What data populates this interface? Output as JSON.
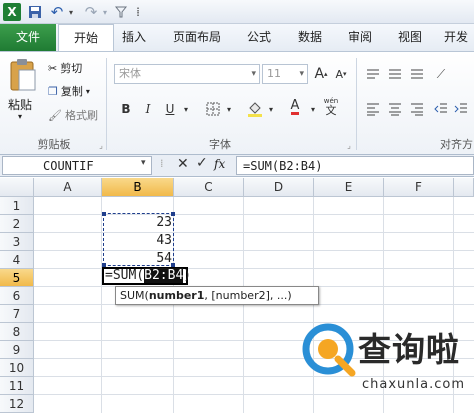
{
  "quick_access": {
    "excel": "X",
    "save": "💾",
    "undo": "↶",
    "redo": "↷",
    "more": "⁞"
  },
  "tabs": [
    {
      "id": "file",
      "label": "文件"
    },
    {
      "id": "home",
      "label": "开始"
    },
    {
      "id": "insert",
      "label": "插入"
    },
    {
      "id": "layout",
      "label": "页面布局"
    },
    {
      "id": "formulas",
      "label": "公式"
    },
    {
      "id": "data",
      "label": "数据"
    },
    {
      "id": "review",
      "label": "审阅"
    },
    {
      "id": "view",
      "label": "视图"
    },
    {
      "id": "dev",
      "label": "开发"
    }
  ],
  "clipboard": {
    "paste": "粘贴",
    "cut": "剪切",
    "copy": "复制",
    "format_painter": "格式刷",
    "group": "剪贴板"
  },
  "font": {
    "name": "宋体",
    "size": "11",
    "bold": "B",
    "italic": "I",
    "underline": "U",
    "grow": "A",
    "shrink": "A",
    "wen": "wén",
    "color_a": "A",
    "group": "字体"
  },
  "align": {
    "group": "对齐方"
  },
  "formula_bar": {
    "name_box": "COUNTIF",
    "fx": "fx",
    "formula": "=SUM(B2:B4)"
  },
  "columns": [
    "A",
    "B",
    "C",
    "D",
    "E",
    "F"
  ],
  "rows": [
    "1",
    "2",
    "3",
    "4",
    "5",
    "6",
    "7",
    "8",
    "9",
    "10",
    "11",
    "12"
  ],
  "cells": {
    "B2": "23",
    "B3": "43",
    "B4": "54"
  },
  "editing": {
    "prefix": "=SUM(",
    "ref": "B2:B4",
    "suffix": ")"
  },
  "tooltip": {
    "func": "SUM(",
    "arg1": "number1",
    "rest": ", [number2], ...)"
  },
  "watermark": {
    "title": "查询啦",
    "url": "chaxunla.com"
  },
  "colors": {
    "file_tab": "#2b8a3e",
    "selected_header": "#f3c15a",
    "marquee": "#1f3e8c",
    "watermark_blue": "#2a8fd6"
  }
}
